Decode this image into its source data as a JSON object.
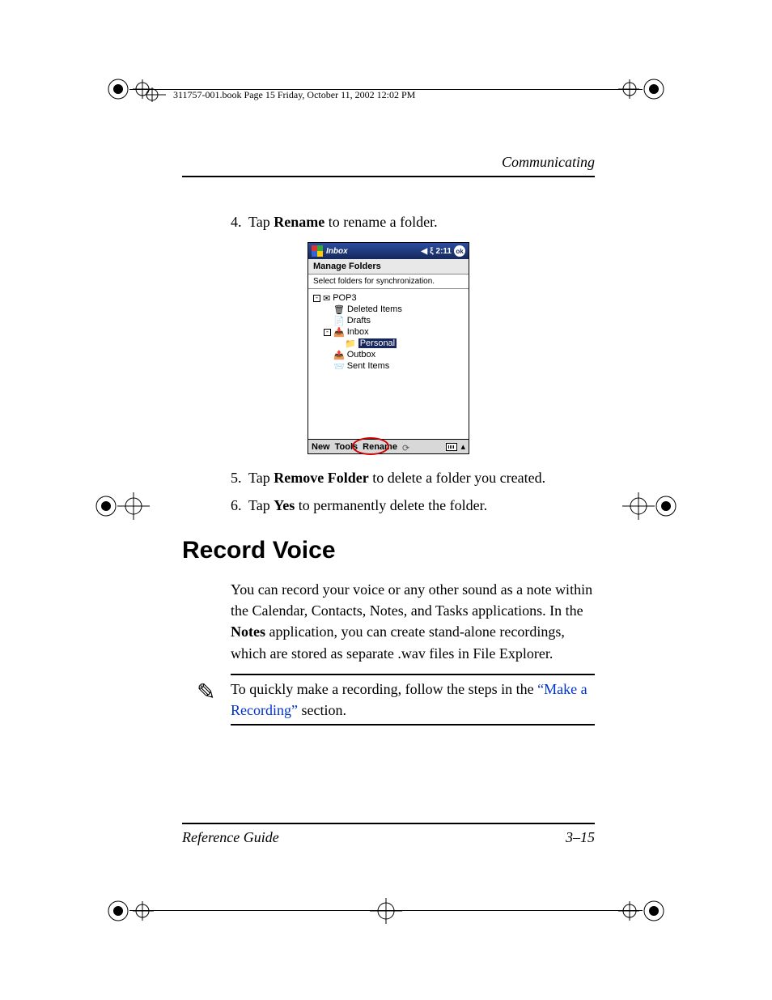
{
  "book_stamp": "311757-001.book  Page 15  Friday, October 11, 2002  12:02 PM",
  "running_head": "Communicating",
  "steps_a": [
    {
      "num": "4.",
      "pre": "Tap ",
      "bold": "Rename",
      "post": " to rename a folder."
    }
  ],
  "steps_b": [
    {
      "num": "5.",
      "pre": "Tap ",
      "bold": "Remove Folder",
      "post": " to delete a folder you created."
    },
    {
      "num": "6.",
      "pre": "Tap ",
      "bold": "Yes",
      "post": " to permanently delete the folder."
    }
  ],
  "heading": "Record Voice",
  "body": {
    "p1_a": "You can record your voice or any other sound as a note within the Calendar, Contacts, Notes, and Tasks applications. In the ",
    "p1_bold": "Notes",
    "p1_b": " application, you can create stand-alone recordings, which are stored as separate .wav files in File Explorer."
  },
  "note": {
    "pre": "To quickly make a recording, follow the steps in the ",
    "link": "“Make a Recording”",
    "post": " section."
  },
  "footer": {
    "left": "Reference Guide",
    "right": "3–15"
  },
  "pda": {
    "title": "Inbox",
    "time": "2:11",
    "ok": "ok",
    "subheader": "Manage Folders",
    "hint": "Select folders for synchronization.",
    "tree": {
      "root": "POP3",
      "items": [
        "Deleted Items",
        "Drafts",
        "Inbox",
        "Personal",
        "Outbox",
        "Sent Items"
      ]
    },
    "bottom": {
      "new": "New",
      "tools": "Tools",
      "rename": "Rename"
    }
  }
}
